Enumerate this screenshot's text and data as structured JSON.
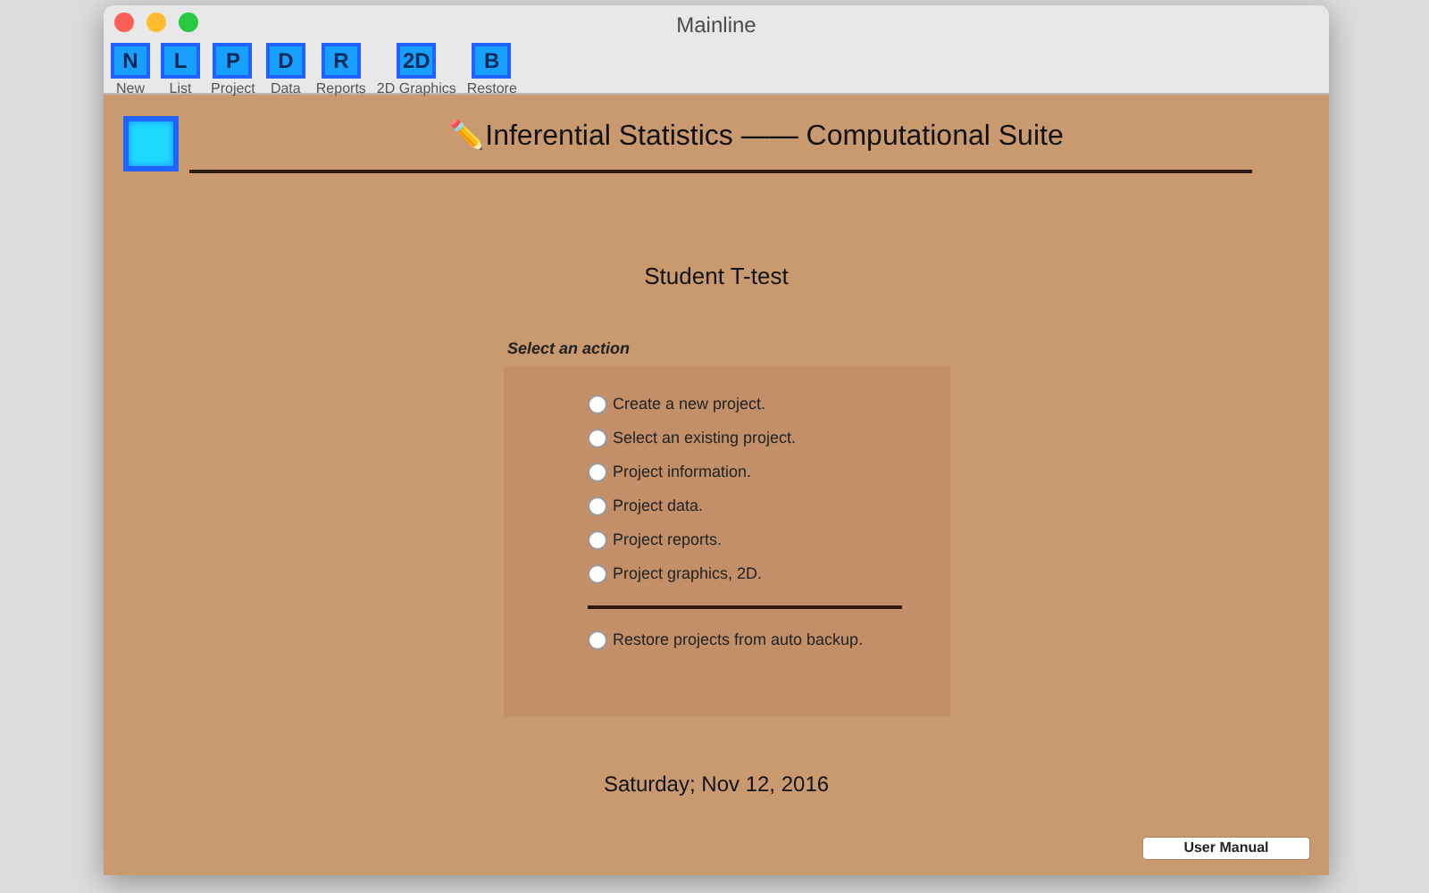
{
  "window": {
    "title": "Mainline"
  },
  "toolbar": [
    {
      "glyph": "N",
      "label": "New"
    },
    {
      "glyph": "L",
      "label": "List"
    },
    {
      "glyph": "P",
      "label": "Project"
    },
    {
      "glyph": "D",
      "label": "Data"
    },
    {
      "glyph": "R",
      "label": "Reports"
    },
    {
      "glyph": "2D",
      "label": "2D Graphics"
    },
    {
      "glyph": "B",
      "label": "Restore"
    }
  ],
  "heading": "✏️Inferential Statistics —— Computational Suite",
  "subtitle": "Student T-test",
  "action_group": {
    "title": "Select an action",
    "options": [
      {
        "kind": "radio",
        "label": "Create a new project.",
        "selected": false
      },
      {
        "kind": "radio",
        "label": "Select an existing project.",
        "selected": false
      },
      {
        "kind": "radio",
        "label": "Project information.",
        "selected": false
      },
      {
        "kind": "radio",
        "label": "Project data.",
        "selected": false
      },
      {
        "kind": "radio",
        "label": "Project reports.",
        "selected": false
      },
      {
        "kind": "radio",
        "label": "Project graphics, 2D.",
        "selected": false
      },
      {
        "kind": "separator"
      },
      {
        "kind": "radio",
        "label": "Restore projects from auto backup.",
        "selected": false
      }
    ]
  },
  "date": "Saturday; Nov 12, 2016",
  "manual_button": "User Manual"
}
